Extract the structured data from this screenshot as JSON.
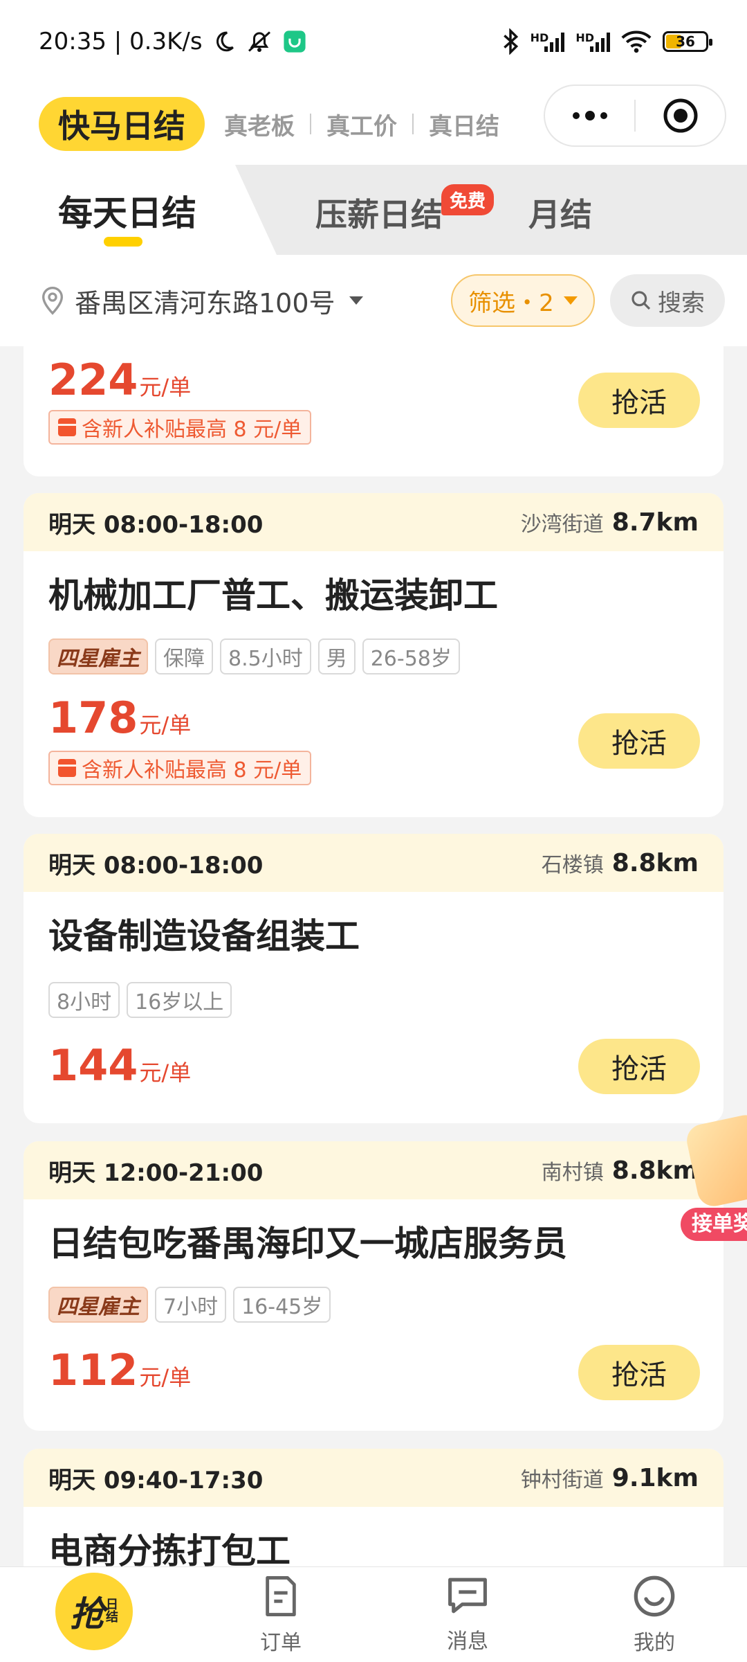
{
  "status_bar": {
    "time_speed": "20:35 | 0.3K/s",
    "battery": "36"
  },
  "header": {
    "logo": "快马日结",
    "slogans": [
      "真老板",
      "真工价",
      "真日结"
    ]
  },
  "tabs": {
    "daily": "每天日结",
    "wage_daily": "压薪日结",
    "wage_badge": "免费",
    "monthly": "月结"
  },
  "filter_bar": {
    "location": "番禺区清河东路100号",
    "filter_label": "筛选・2",
    "search_label": "搜索"
  },
  "jobs": [
    {
      "price": "224",
      "unit": "元/单",
      "subsidy": "含新人补贴最高 8 元/单",
      "action": "抢活"
    },
    {
      "time": "明天 08:00-18:00",
      "area": "沙湾街道",
      "distance": "8.7km",
      "title": "机械加工厂普工、搬运装卸工",
      "tags": [
        "四星雇主",
        "保障",
        "8.5小时",
        "男",
        "26-58岁"
      ],
      "price": "178",
      "unit": "元/单",
      "subsidy": "含新人补贴最高 8 元/单",
      "action": "抢活"
    },
    {
      "time": "明天 08:00-18:00",
      "area": "石楼镇",
      "distance": "8.8km",
      "title": "设备制造设备组装工",
      "tags": [
        "8小时",
        "16岁以上"
      ],
      "price": "144",
      "unit": "元/单",
      "action": "抢活"
    },
    {
      "time": "明天 12:00-21:00",
      "area": "南村镇",
      "distance": "8.8km",
      "title": "日结包吃番禺海印又一城店服务员",
      "tags": [
        "四星雇主",
        "7小时",
        "16-45岁"
      ],
      "price": "112",
      "unit": "元/单",
      "action": "抢活"
    },
    {
      "time": "明天 09:40-17:30",
      "area": "钟村街道",
      "distance": "9.1km",
      "title": "电商分拣打包工"
    }
  ],
  "floating": {
    "label": "接单奖"
  },
  "bottom_nav": {
    "main_big": "抢",
    "main_small_1": "日",
    "main_small_2": "结",
    "orders": "订单",
    "messages": "消息",
    "mine": "我的"
  }
}
